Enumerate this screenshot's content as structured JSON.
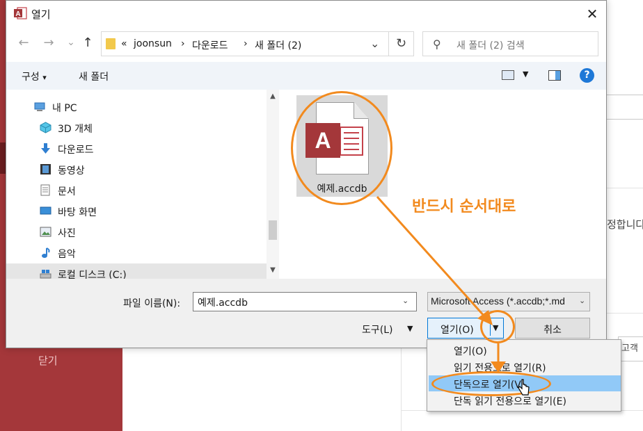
{
  "background": {
    "close_label": "닫기",
    "fragment_right": "정합니다",
    "fragment_right2": "고객",
    "colors": {
      "sidebar": "#a4373a",
      "accent": "#f28a1e",
      "selection": "#91c9f7"
    }
  },
  "dialog": {
    "title": "열기",
    "icons": {
      "app": "access-app-icon",
      "close": "close-icon"
    }
  },
  "nav_buttons": {
    "back": "←",
    "forward": "→",
    "recent": "⌄",
    "up": "↑"
  },
  "address": {
    "prefix": "«",
    "crumbs": [
      "joonsun",
      "다운로드",
      "새 폴더 (2)"
    ],
    "separator": "›",
    "dropdown_glyph": "⌄",
    "refresh_glyph": "↻"
  },
  "search": {
    "placeholder": "새 폴더 (2) 검색",
    "icon_glyph": "⚲"
  },
  "toolbar": {
    "organize": "구성",
    "organize_caret": "▾",
    "new_folder": "새 폴더",
    "view_caret": "▼",
    "help": "?"
  },
  "nav_pane": {
    "items": [
      {
        "label": "내 PC",
        "icon": "computer-icon"
      },
      {
        "label": "3D 개체",
        "icon": "cube-icon"
      },
      {
        "label": "다운로드",
        "icon": "download-arrow-icon"
      },
      {
        "label": "동영상",
        "icon": "film-icon"
      },
      {
        "label": "문서",
        "icon": "document-icon"
      },
      {
        "label": "바탕 화면",
        "icon": "desktop-icon"
      },
      {
        "label": "사진",
        "icon": "picture-icon"
      },
      {
        "label": "음악",
        "icon": "music-note-icon"
      },
      {
        "label": "로컬 디스크 (C:)",
        "icon": "drive-icon"
      }
    ],
    "scroll_up": "▲",
    "scroll_down": "▼"
  },
  "file": {
    "name": "예제.accdb",
    "badge": "A"
  },
  "bottom": {
    "filename_label": "파일 이름(N):",
    "filename_value": "예제.accdb",
    "filetype_value": "Microsoft Access (*.accdb;*.md",
    "tools_label": "도구(L)",
    "open_label": "열기(O)",
    "cancel_label": "취소",
    "caret": "▼"
  },
  "open_menu": {
    "items": [
      "열기(O)",
      "읽기 전용으로 열기(R)",
      "단독으로 열기(V)",
      "단독 읽기 전용으로 열기(E)"
    ],
    "highlighted_index": 2
  },
  "annotation": {
    "text": "반드시 순서대로"
  }
}
